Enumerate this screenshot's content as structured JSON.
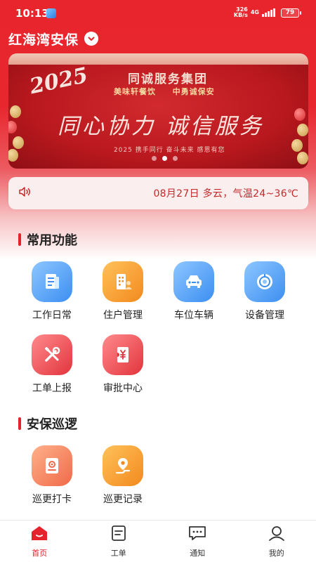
{
  "status_bar": {
    "time": "10:13",
    "net_speed_value": "326",
    "net_speed_unit": "KB/s",
    "network": "4G",
    "battery": "79"
  },
  "header": {
    "community_name": "红海湾安保"
  },
  "banner": {
    "year_text": "2025",
    "company": "同诚服务集团",
    "sub_left": "美味轩餐饮",
    "sub_right": "中勇诚保安",
    "slogan": "同心协力 诚信服务",
    "footer": "2025 携手同行 奋斗未来 感恩有您",
    "dots": 3,
    "active_dot": 1
  },
  "weather": {
    "text": "08月27日 多云，气温24~36℃"
  },
  "sections": {
    "common": {
      "title": "常用功能",
      "items": [
        {
          "label": "工作日常",
          "icon": "document-icon",
          "color": "blue"
        },
        {
          "label": "住户管理",
          "icon": "building-person-icon",
          "color": "orange"
        },
        {
          "label": "车位车辆",
          "icon": "car-icon",
          "color": "blue"
        },
        {
          "label": "设备管理",
          "icon": "device-ring-icon",
          "color": "blue"
        },
        {
          "label": "工单上报",
          "icon": "tools-icon",
          "color": "red"
        },
        {
          "label": "审批中心",
          "icon": "approval-ticket-icon",
          "color": "red"
        }
      ]
    },
    "patrol": {
      "title": "安保巡逻",
      "items": [
        {
          "label": "巡更打卡",
          "icon": "patrol-checkin-icon",
          "color": "salmon"
        },
        {
          "label": "巡更记录",
          "icon": "route-pin-icon",
          "color": "orange"
        }
      ]
    }
  },
  "tabbar": {
    "items": [
      {
        "label": "首页",
        "icon": "home-icon",
        "active": true
      },
      {
        "label": "工单",
        "icon": "clipboard-icon",
        "active": false
      },
      {
        "label": "通知",
        "icon": "chat-icon",
        "active": false
      },
      {
        "label": "我的",
        "icon": "user-icon",
        "active": false
      }
    ]
  },
  "colors": {
    "brand": "#e5232c",
    "weather_text": "#c22a2a",
    "blue_icon": "#3c8ff2",
    "orange_icon": "#f28a1e"
  }
}
